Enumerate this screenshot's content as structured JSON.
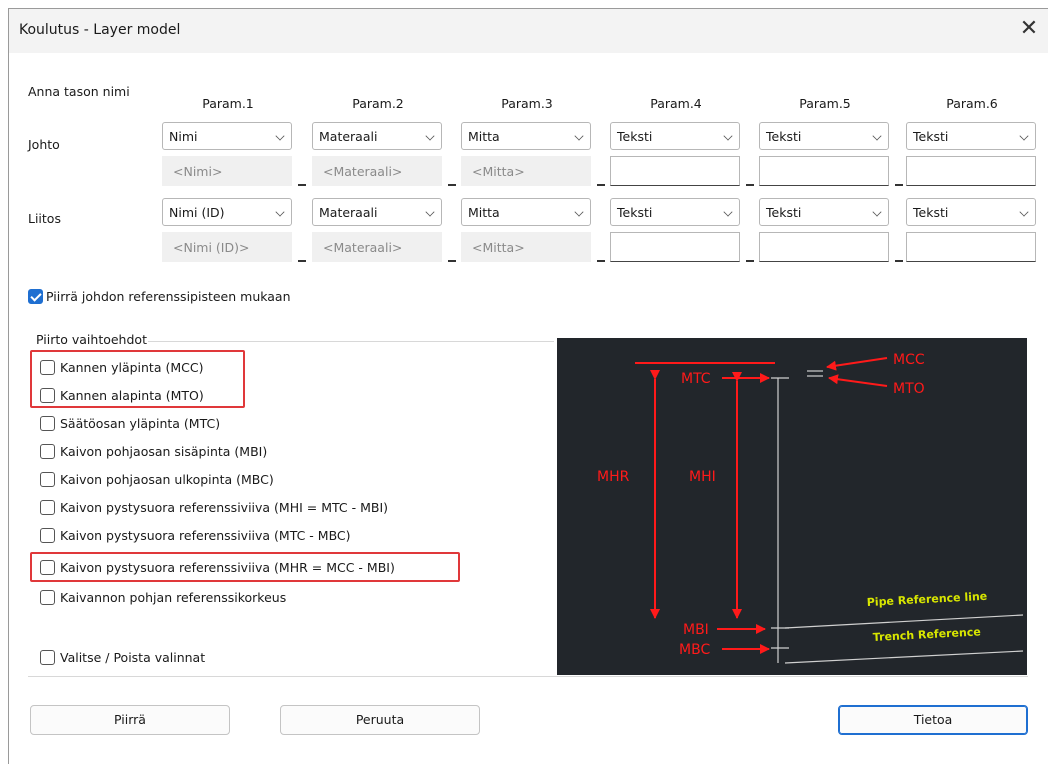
{
  "window": {
    "title": "Koulutus - Layer model",
    "close_glyph": "✕"
  },
  "intro_label": "Anna tason nimi",
  "params": [
    "Param.1",
    "Param.2",
    "Param.3",
    "Param.4",
    "Param.5",
    "Param.6"
  ],
  "rows": {
    "johto": {
      "label": "Johto",
      "selects": [
        "Nimi",
        "Materaali",
        "Mitta",
        "Teksti",
        "Teksti",
        "Teksti"
      ],
      "fields": [
        "<Nimi>",
        "<Materaali>",
        "<Mitta>",
        "",
        "",
        ""
      ]
    },
    "liitos": {
      "label": "Liitos",
      "selects": [
        "Nimi (ID)",
        "Materaali",
        "Mitta",
        "Teksti",
        "Teksti",
        "Teksti"
      ],
      "fields": [
        "<Nimi (ID)>",
        "<Materaali>",
        "<Mitta>",
        "",
        "",
        ""
      ]
    }
  },
  "draw_by_reference": {
    "label": "Piirrä johdon referenssipisteen mukaan",
    "checked": true
  },
  "options_group": {
    "title": "Piirto vaihtoehdot",
    "options": [
      {
        "label": "Kannen yläpinta (MCC)",
        "checked": false
      },
      {
        "label": "Kannen alapinta (MTO)",
        "checked": false
      },
      {
        "label": "Säätöosan yläpinta (MTC)",
        "checked": false
      },
      {
        "label": "Kaivon pohjaosan sisäpinta (MBI)",
        "checked": false
      },
      {
        "label": "Kaivon pohjaosan ulkopinta (MBC)",
        "checked": false
      },
      {
        "label": "Kaivon pystysuora referenssiviiva (MHI = MTC - MBI)",
        "checked": false
      },
      {
        "label": "Kaivon pystysuora referenssiviiva (MTC - MBC)",
        "checked": false
      },
      {
        "label": "Kaivon pystysuora referenssiviiva (MHR = MCC - MBI)",
        "checked": false
      },
      {
        "label": "Kaivannon pohjan referenssikorkeus",
        "checked": false
      }
    ],
    "toggle_all": {
      "label": "Valitse / Poista valinnat",
      "checked": false
    }
  },
  "diagram": {
    "labels": {
      "mcc": "MCC",
      "mto": "MTO",
      "mtc": "MTC",
      "mhr": "MHR",
      "mhi": "MHI",
      "mbi": "MBI",
      "mbc": "MBC",
      "pipe_ref": "Pipe Reference line",
      "trench_ref": "Trench Reference"
    },
    "colors": {
      "background": "#22262b",
      "marker": "#ff1a1a",
      "reference_text": "#d8e600",
      "line": "#d0d0d0"
    }
  },
  "buttons": {
    "draw": "Piirrä",
    "cancel": "Peruuta",
    "info": "Tietoa"
  },
  "icons": {
    "dropdown": "chevron-down-icon",
    "close": "close-icon",
    "check": "checkmark-icon"
  }
}
